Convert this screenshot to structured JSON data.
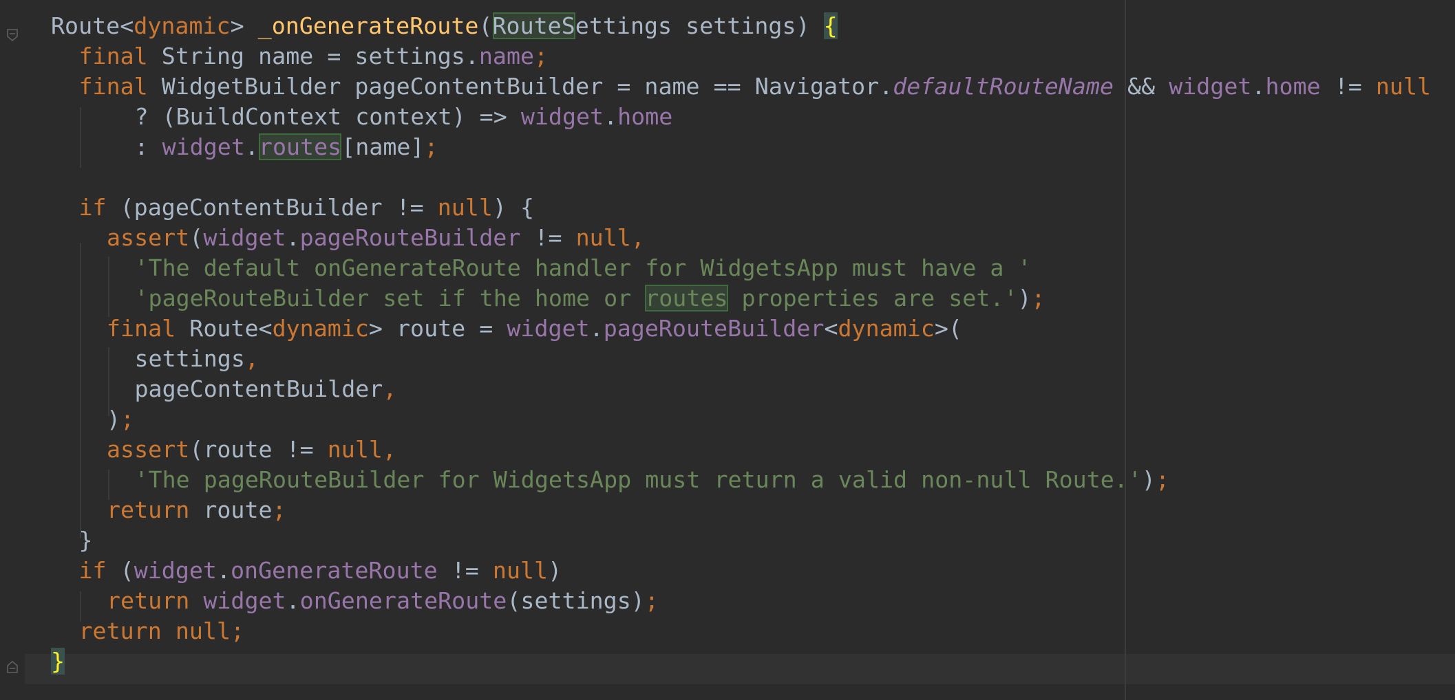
{
  "editor": {
    "language": "Dart",
    "colors": {
      "background": "#2b2b2b",
      "plain": "#a9b7c6",
      "keyword": "#cc7832",
      "function_decl": "#ffc66d",
      "field": "#9876aa",
      "string": "#6a8759",
      "brace_match": "#ffef28",
      "usage_highlight": "#344134",
      "caret_line": "#323232"
    },
    "lines": [
      {
        "indent": 0,
        "tokens": [
          {
            "t": "Route<",
            "c": "plain"
          },
          {
            "t": "dynamic",
            "c": "kw"
          },
          {
            "t": "> ",
            "c": "plain"
          },
          {
            "t": "_onGenerateRoute",
            "c": "fn"
          },
          {
            "t": "(",
            "c": "plain"
          },
          {
            "t": "RouteS",
            "c": "usage"
          },
          {
            "t": "ettings settings) ",
            "c": "plain"
          },
          {
            "t": "{",
            "c": "brace-hl"
          }
        ]
      },
      {
        "indent": 1,
        "tokens": [
          {
            "t": "final ",
            "c": "kw"
          },
          {
            "t": "String name = settings.",
            "c": "plain"
          },
          {
            "t": "name",
            "c": "fld"
          },
          {
            "t": ";",
            "c": "kw"
          }
        ]
      },
      {
        "indent": 1,
        "tokens": [
          {
            "t": "final ",
            "c": "kw"
          },
          {
            "t": "WidgetBuilder pageContentBuilder = name == Navigator.",
            "c": "plain"
          },
          {
            "t": "defaultRouteName",
            "c": "ital"
          },
          {
            "t": " && ",
            "c": "plain"
          },
          {
            "t": "widget",
            "c": "fld"
          },
          {
            "t": ".",
            "c": "plain"
          },
          {
            "t": "home",
            "c": "fld"
          },
          {
            "t": " != ",
            "c": "plain"
          },
          {
            "t": "null",
            "c": "kw"
          }
        ]
      },
      {
        "indent": 3,
        "tokens": [
          {
            "t": "? (BuildContext context) => ",
            "c": "plain"
          },
          {
            "t": "widget",
            "c": "fld"
          },
          {
            "t": ".",
            "c": "plain"
          },
          {
            "t": "home",
            "c": "fld"
          }
        ]
      },
      {
        "indent": 3,
        "tokens": [
          {
            "t": ": ",
            "c": "plain"
          },
          {
            "t": "widget",
            "c": "fld"
          },
          {
            "t": ".",
            "c": "plain"
          },
          {
            "t": "routes",
            "c": "fld usage"
          },
          {
            "t": "[name]",
            "c": "plain"
          },
          {
            "t": ";",
            "c": "kw"
          }
        ]
      },
      {
        "indent": 0,
        "tokens": []
      },
      {
        "indent": 1,
        "tokens": [
          {
            "t": "if ",
            "c": "kw"
          },
          {
            "t": "(pageContentBuilder != ",
            "c": "plain"
          },
          {
            "t": "null",
            "c": "kw"
          },
          {
            "t": ") {",
            "c": "plain"
          }
        ]
      },
      {
        "indent": 2,
        "tokens": [
          {
            "t": "assert",
            "c": "kw"
          },
          {
            "t": "(",
            "c": "plain"
          },
          {
            "t": "widget",
            "c": "fld"
          },
          {
            "t": ".",
            "c": "plain"
          },
          {
            "t": "pageRouteBuilder",
            "c": "fld"
          },
          {
            "t": " != ",
            "c": "plain"
          },
          {
            "t": "null,",
            "c": "kw"
          }
        ]
      },
      {
        "indent": 3,
        "tokens": [
          {
            "t": "'The default onGenerateRoute handler for WidgetsApp must have a '",
            "c": "str"
          }
        ]
      },
      {
        "indent": 3,
        "tokens": [
          {
            "t": "'pageRouteBuilder set if the home or ",
            "c": "str"
          },
          {
            "t": "routes",
            "c": "str usage"
          },
          {
            "t": " properties are set.'",
            "c": "str"
          },
          {
            "t": ")",
            "c": "plain"
          },
          {
            "t": ";",
            "c": "kw"
          }
        ]
      },
      {
        "indent": 2,
        "tokens": [
          {
            "t": "final ",
            "c": "kw"
          },
          {
            "t": "Route<",
            "c": "plain"
          },
          {
            "t": "dynamic",
            "c": "kw"
          },
          {
            "t": "> route = ",
            "c": "plain"
          },
          {
            "t": "widget",
            "c": "fld"
          },
          {
            "t": ".",
            "c": "plain"
          },
          {
            "t": "pageRouteBuilder",
            "c": "fld"
          },
          {
            "t": "<",
            "c": "plain"
          },
          {
            "t": "dynamic",
            "c": "kw"
          },
          {
            "t": ">(",
            "c": "plain"
          }
        ]
      },
      {
        "indent": 3,
        "tokens": [
          {
            "t": "settings",
            "c": "plain"
          },
          {
            "t": ",",
            "c": "kw"
          }
        ]
      },
      {
        "indent": 3,
        "tokens": [
          {
            "t": "pageContentBuilder",
            "c": "plain"
          },
          {
            "t": ",",
            "c": "kw"
          }
        ]
      },
      {
        "indent": 2,
        "tokens": [
          {
            "t": ")",
            "c": "plain"
          },
          {
            "t": ";",
            "c": "kw"
          }
        ]
      },
      {
        "indent": 2,
        "tokens": [
          {
            "t": "assert",
            "c": "kw"
          },
          {
            "t": "(route != ",
            "c": "plain"
          },
          {
            "t": "null,",
            "c": "kw"
          }
        ]
      },
      {
        "indent": 3,
        "tokens": [
          {
            "t": "'The pageRouteBuilder for WidgetsApp must return a valid non-null Route.'",
            "c": "str"
          },
          {
            "t": ")",
            "c": "plain"
          },
          {
            "t": ";",
            "c": "kw"
          }
        ]
      },
      {
        "indent": 2,
        "tokens": [
          {
            "t": "return ",
            "c": "kw"
          },
          {
            "t": "route",
            "c": "plain"
          },
          {
            "t": ";",
            "c": "kw"
          }
        ]
      },
      {
        "indent": 1,
        "tokens": [
          {
            "t": "}",
            "c": "plain"
          }
        ]
      },
      {
        "indent": 1,
        "tokens": [
          {
            "t": "if ",
            "c": "kw"
          },
          {
            "t": "(",
            "c": "plain"
          },
          {
            "t": "widget",
            "c": "fld"
          },
          {
            "t": ".",
            "c": "plain"
          },
          {
            "t": "onGenerateRoute",
            "c": "fld"
          },
          {
            "t": " != ",
            "c": "plain"
          },
          {
            "t": "null",
            "c": "kw"
          },
          {
            "t": ")",
            "c": "plain"
          }
        ]
      },
      {
        "indent": 2,
        "tokens": [
          {
            "t": "return ",
            "c": "kw"
          },
          {
            "t": "widget",
            "c": "fld"
          },
          {
            "t": ".",
            "c": "plain"
          },
          {
            "t": "onGenerateRoute",
            "c": "fld"
          },
          {
            "t": "(settings)",
            "c": "plain"
          },
          {
            "t": ";",
            "c": "kw"
          }
        ]
      },
      {
        "indent": 1,
        "tokens": [
          {
            "t": "return null",
            "c": "kw"
          },
          {
            "t": ";",
            "c": "kw"
          }
        ]
      },
      {
        "indent": 0,
        "tokens": [
          {
            "t": "}",
            "c": "brace-hl"
          }
        ]
      }
    ]
  }
}
